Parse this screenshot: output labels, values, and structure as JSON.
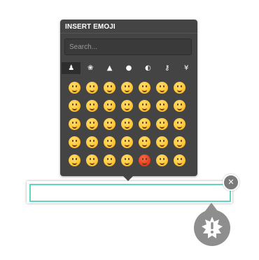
{
  "panel": {
    "title": "INSERT EMOJI",
    "search_placeholder": "Search..."
  },
  "tabs": [
    {
      "icon": "people-icon",
      "glyph": "♟",
      "active": true
    },
    {
      "icon": "nature-icon",
      "glyph": "❀",
      "active": false
    },
    {
      "icon": "food-icon",
      "glyph": "▲",
      "active": false
    },
    {
      "icon": "activity-icon",
      "glyph": "●",
      "active": false
    },
    {
      "icon": "travel-icon",
      "glyph": "◐",
      "active": false
    },
    {
      "icon": "objects-icon",
      "glyph": "⚷",
      "active": false
    },
    {
      "icon": "symbols-icon",
      "glyph": "¥",
      "active": false
    }
  ],
  "emojis": [
    "grinning",
    "grimacing",
    "grin",
    "joy",
    "smiley",
    "smile",
    "sweat-smile",
    "laughing",
    "innocent",
    "wink",
    "blush",
    "slightly-smiling",
    "upside-down",
    "relieved",
    "heart-eyes",
    "kissing-heart",
    "kissing",
    "kissing-smiling",
    "kissing-closed-eyes",
    "stuck-out-tongue-wink",
    "stuck-out-tongue-closed",
    "stuck-out-tongue",
    "sunglasses",
    "smirk",
    "no-mouth",
    "neutral",
    "expressionless",
    "unamused",
    "flushed",
    "disappointed",
    "worried",
    "angry",
    "rage",
    "pensive",
    "confused"
  ],
  "input": {
    "value": ""
  },
  "close_glyph": "✕",
  "colors": {
    "panel_bg": "#444444",
    "accent_border": "#5fd6c2",
    "alert_bg": "#8e8e8e"
  }
}
